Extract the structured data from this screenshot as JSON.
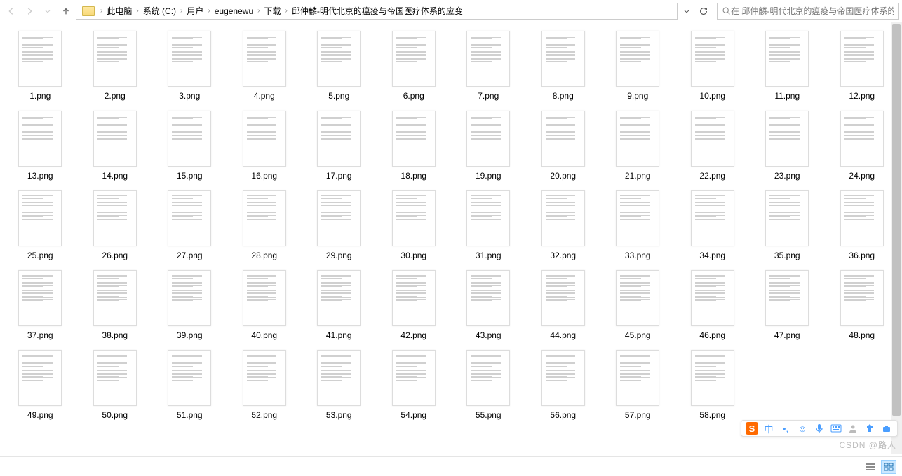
{
  "breadcrumb": [
    "此电脑",
    "系统 (C:)",
    "用户",
    "eugenewu",
    "下载",
    "邱仲麟-明代北京的瘟疫与帝国医疗体系的应变"
  ],
  "search_placeholder": "在 邱仲麟-明代北京的瘟疫与帝国医疗体系的...",
  "file_count": 58,
  "file_ext": ".png",
  "watermark": "CSDN @路人",
  "ime": {
    "logo": "S",
    "lang": "中"
  }
}
